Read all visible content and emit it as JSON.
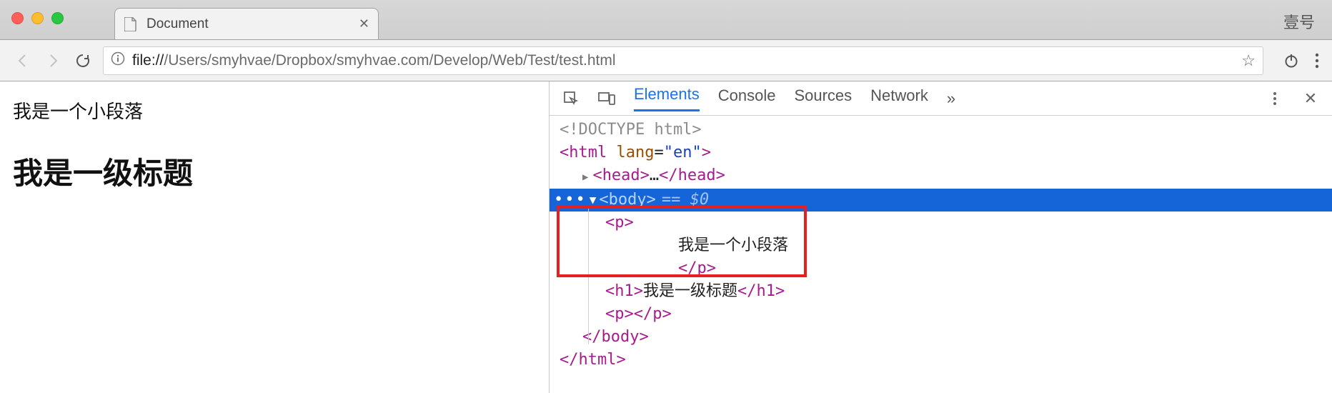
{
  "chrome": {
    "tab_title": "Document",
    "profile_label": "壹号",
    "url_scheme": "file://",
    "url_rest": "/Users/smyhvae/Dropbox/smyhvae.com/Develop/Web/Test/test.html"
  },
  "page": {
    "paragraph": "我是一个小段落",
    "heading": "我是一级标题"
  },
  "devtools": {
    "tabs": {
      "elements": "Elements",
      "console": "Console",
      "sources": "Sources",
      "network": "Network"
    },
    "dom": {
      "doctype": "<!DOCTYPE html>",
      "html_open_tag": "html",
      "html_attr_name": "lang",
      "html_attr_val": "en",
      "head_tag": "head",
      "head_ellipsis": "…",
      "body_tag": "body",
      "selected_suffix": "== $0",
      "p_tag": "p",
      "p_text": "我是一个小段落",
      "h1_tag": "h1",
      "h1_text": "我是一级标题"
    }
  }
}
